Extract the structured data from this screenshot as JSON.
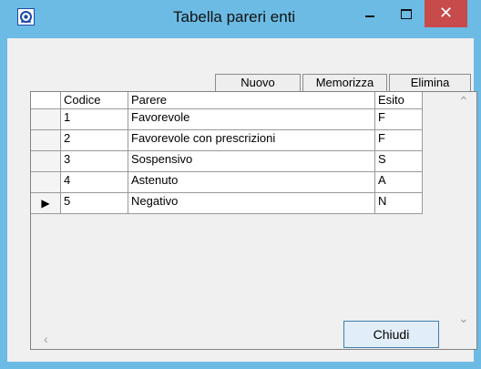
{
  "window": {
    "title": "Tabella pareri enti",
    "close_glyph": "✕"
  },
  "toolbar": {
    "new_label": "Nuovo",
    "save_label": "Memorizza",
    "delete_label": "Elimina"
  },
  "table": {
    "columns": [
      "Codice",
      "Parere",
      "Esito"
    ],
    "rows": [
      {
        "codice": "1",
        "parere": "Favorevole",
        "esito": "F"
      },
      {
        "codice": "2",
        "parere": "Favorevole con prescrizioni",
        "esito": "F"
      },
      {
        "codice": "3",
        "parere": "Sospensivo",
        "esito": "S"
      },
      {
        "codice": "4",
        "parere": "Astenuto",
        "esito": "A"
      },
      {
        "codice": "5",
        "parere": "Negativo",
        "esito": "N"
      }
    ],
    "current_row_marker": "▶"
  },
  "footer": {
    "close_label": "Chiudi"
  },
  "icons": {
    "app": "app-icon",
    "minimize": "minimize-icon",
    "maximize": "maximize-icon",
    "close": "close-icon",
    "scroll_up": "chevron-up-icon",
    "scroll_down": "chevron-down-icon",
    "scroll_left": "chevron-left-icon",
    "scroll_right": "chevron-right-icon"
  },
  "colors": {
    "titlebar": "#6cbbe4",
    "close_button": "#c74b4b",
    "client_bg": "#f0f0f0",
    "default_button_border": "#3c7fb1"
  }
}
